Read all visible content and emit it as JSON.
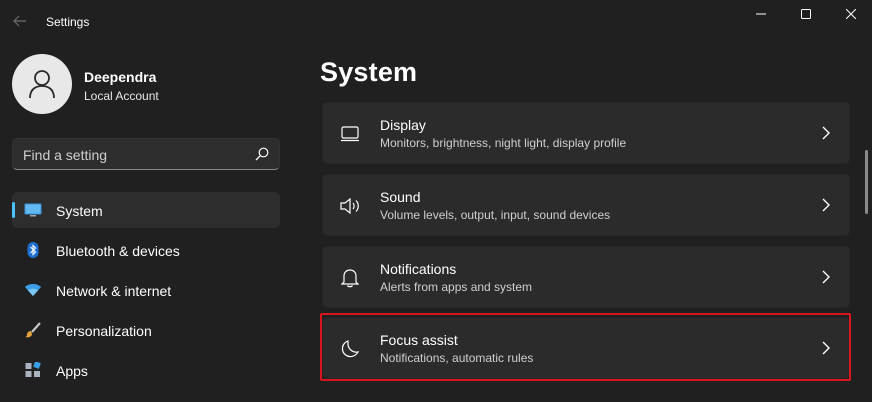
{
  "window": {
    "title": "Settings"
  },
  "profile": {
    "name": "Deependra",
    "account_type": "Local Account"
  },
  "search": {
    "placeholder": "Find a setting"
  },
  "sidebar": {
    "items": [
      {
        "label": "System",
        "icon": "system-display-icon",
        "active": true
      },
      {
        "label": "Bluetooth & devices",
        "icon": "bluetooth-icon",
        "active": false
      },
      {
        "label": "Network & internet",
        "icon": "wifi-icon",
        "active": false
      },
      {
        "label": "Personalization",
        "icon": "brush-icon",
        "active": false
      },
      {
        "label": "Apps",
        "icon": "apps-icon",
        "active": false
      }
    ]
  },
  "main": {
    "title": "System",
    "cards": [
      {
        "title": "Display",
        "desc": "Monitors, brightness, night light, display profile",
        "icon": "monitor-icon"
      },
      {
        "title": "Sound",
        "desc": "Volume levels, output, input, sound devices",
        "icon": "speaker-icon"
      },
      {
        "title": "Notifications",
        "desc": "Alerts from apps and system",
        "icon": "bell-icon"
      },
      {
        "title": "Focus assist",
        "desc": "Notifications, automatic rules",
        "icon": "moon-icon",
        "highlighted": true
      }
    ]
  },
  "colors": {
    "background": "#202020",
    "card": "#2b2b2b",
    "accent": "#4cc2ff",
    "highlight_border": "#d9151f"
  }
}
